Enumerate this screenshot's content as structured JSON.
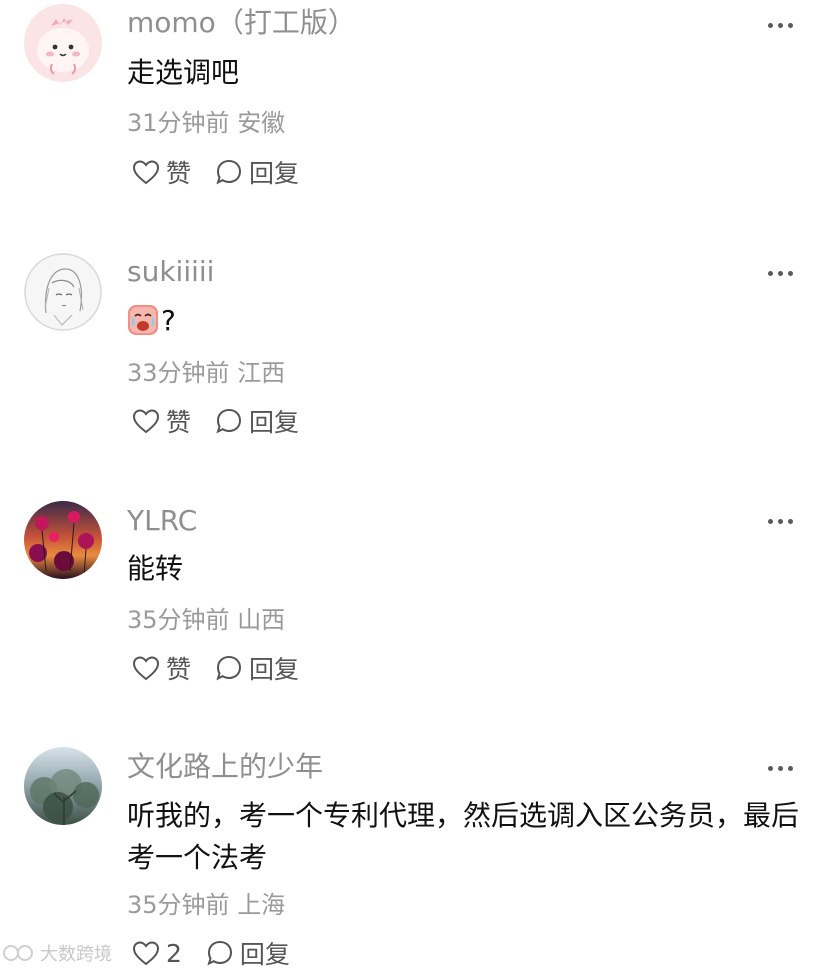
{
  "comments": [
    {
      "username": "momo（打工版）",
      "content": "走选调吧",
      "time": "31分钟前",
      "location": "安徽",
      "like_label": "赞",
      "reply_label": "回复",
      "avatar": "pink-cartoon-avatar"
    },
    {
      "username": "sukiiiii",
      "content_suffix": "?",
      "content_emoji": "crying-face-emoji",
      "time": "33分钟前",
      "location": "江西",
      "like_label": "赞",
      "reply_label": "回复",
      "avatar": "sketch-portrait-avatar"
    },
    {
      "username": "YLRC",
      "content": "能转",
      "time": "35分钟前",
      "location": "山西",
      "like_label": "赞",
      "reply_label": "回复",
      "avatar": "flowers-sunset-avatar"
    },
    {
      "username": "文化路上的少年",
      "content": "听我的，考一个专利代理，然后选调入区公务员，最后考一个法考",
      "time": "35分钟前",
      "location": "上海",
      "like_label": "2",
      "reply_label": "回复",
      "avatar": "misty-tree-avatar"
    }
  ],
  "watermark": "大数跨境",
  "colors": {
    "username": "#8f8f8f",
    "content": "#111111",
    "meta": "#9a9a9a",
    "action": "#555555"
  }
}
